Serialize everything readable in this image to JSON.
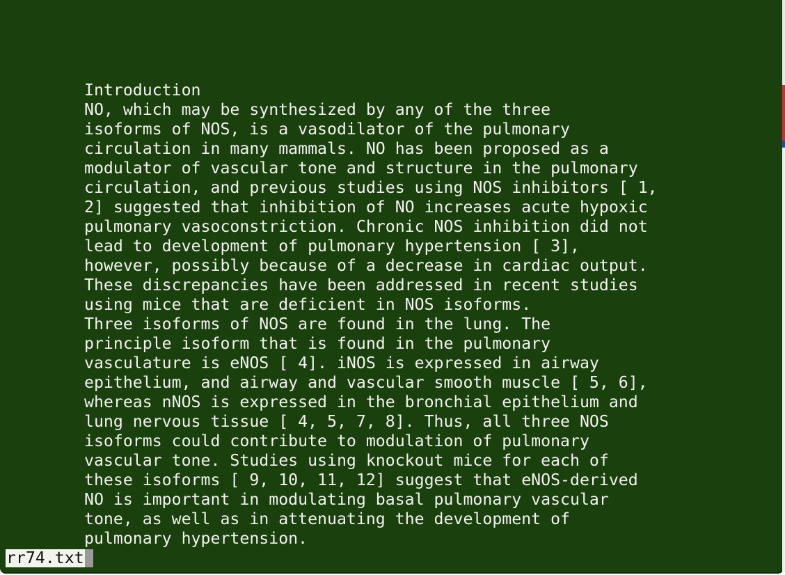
{
  "document": {
    "lines": [
      "Introduction",
      "NO, which may be synthesized by any of the three",
      "isoforms of NOS, is a vasodilator of the pulmonary",
      "circulation in many mammals. NO has been proposed as a",
      "modulator of vascular tone and structure in the pulmonary",
      "circulation, and previous studies using NOS inhibitors [ 1,",
      "2] suggested that inhibition of NO increases acute hypoxic",
      "pulmonary vasoconstriction. Chronic NOS inhibition did not",
      "lead to development of pulmonary hypertension [ 3],",
      "however, possibly because of a decrease in cardiac output.",
      "These discrepancies have been addressed in recent studies",
      "using mice that are deficient in NOS isoforms.",
      "Three isoforms of NOS are found in the lung. The",
      "principle isoform that is found in the pulmonary",
      "vasculature is eNOS [ 4]. iNOS is expressed in airway",
      "epithelium, and airway and vascular smooth muscle [ 5, 6],",
      "whereas nNOS is expressed in the bronchial epithelium and",
      "lung nervous tissue [ 4, 5, 7, 8]. Thus, all three NOS",
      "isoforms could contribute to modulation of pulmonary",
      "vascular tone. Studies using knockout mice for each of",
      "these isoforms [ 9, 10, 11, 12] suggest that eNOS-derived",
      "NO is important in modulating basal pulmonary vascular",
      "tone, as well as in attenuating the development of",
      "pulmonary hypertension."
    ]
  },
  "status": {
    "file_name": "rr74.txt"
  },
  "colors": {
    "background": "#1a400d",
    "text": "#f2f2ee",
    "status_bg": "#f4f4ef",
    "cursor": "#9a9a98"
  }
}
